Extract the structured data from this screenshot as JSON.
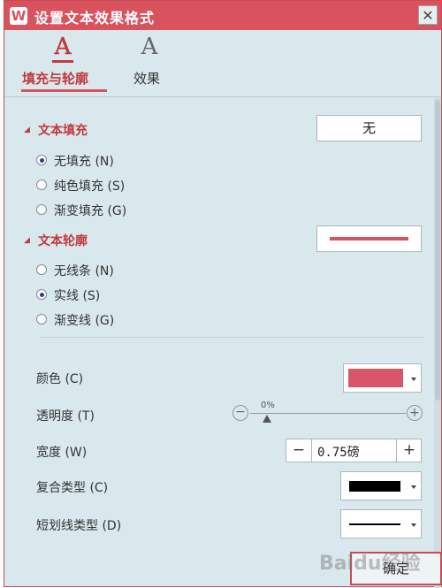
{
  "window": {
    "title": "设置文本效果格式",
    "logo_letter": "W",
    "close_glyph": "✕"
  },
  "tabs": [
    {
      "label": "填充与轮廓",
      "icon": "A"
    },
    {
      "label": "效果",
      "icon": "A"
    }
  ],
  "text_fill": {
    "title": "文本填充",
    "dropdown_value": "无",
    "options": [
      "无填充 (N)",
      "纯色填充 (S)",
      "渐变填充 (G)"
    ]
  },
  "text_outline": {
    "title": "文本轮廓",
    "line_color": "#d9535f",
    "options": [
      "无线条 (N)",
      "实线 (S)",
      "渐变线 (G)"
    ]
  },
  "properties": {
    "color_label": "颜色 (C)",
    "color_value": "#d9566a",
    "transparency_label": "透明度 (T)",
    "transparency_value": "0%",
    "width_label": "宽度 (W)",
    "width_value": "0.75磅",
    "minus": "−",
    "plus": "+",
    "compound_label": "复合类型 (C)",
    "dash_label": "短划线类型 (D)"
  },
  "buttons": {
    "ok": "确定"
  },
  "watermark": "Baidu经验",
  "colors": {
    "accent": "#d9535f",
    "panel": "#d9e8ec"
  }
}
